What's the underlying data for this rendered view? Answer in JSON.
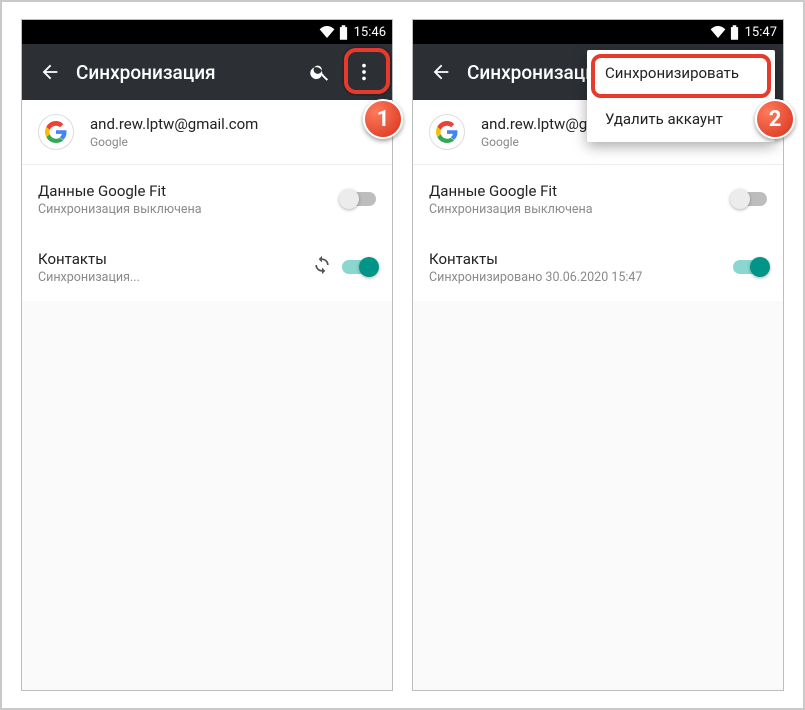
{
  "left": {
    "status": {
      "time": "15:46"
    },
    "header": {
      "title": "Синхронизация"
    },
    "account": {
      "email": "and.rew.lptw@gmail.com",
      "provider": "Google"
    },
    "items": [
      {
        "title": "Данные Google Fit",
        "sub": "Синхронизация выключена",
        "on": false,
        "syncing": false
      },
      {
        "title": "Контакты",
        "sub": "Синхронизация...",
        "on": true,
        "syncing": true
      }
    ],
    "step": "1"
  },
  "right": {
    "status": {
      "time": "15:47"
    },
    "header": {
      "title": "Синхронизация"
    },
    "account": {
      "email": "and.rew.lptw@gmail.com",
      "provider": "Google"
    },
    "items": [
      {
        "title": "Данные Google Fit",
        "sub": "Синхронизация выключена",
        "on": false,
        "syncing": false
      },
      {
        "title": "Контакты",
        "sub": "Синхронизировано 30.06.2020 15:47",
        "on": true,
        "syncing": false
      }
    ],
    "menu": {
      "sync": "Синхронизировать",
      "delete": "Удалить аккаунт"
    },
    "step": "2"
  }
}
